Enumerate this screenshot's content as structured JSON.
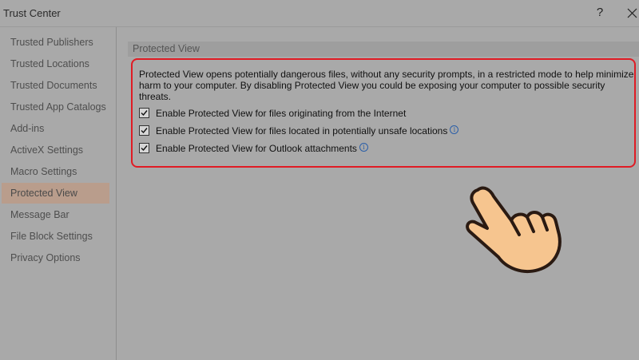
{
  "window": {
    "title": "Trust Center",
    "help_label": "?"
  },
  "sidebar": {
    "items": [
      {
        "label": "Trusted Publishers"
      },
      {
        "label": "Trusted Locations"
      },
      {
        "label": "Trusted Documents"
      },
      {
        "label": "Trusted App Catalogs"
      },
      {
        "label": "Add-ins"
      },
      {
        "label": "ActiveX Settings"
      },
      {
        "label": "Macro Settings"
      },
      {
        "label": "Protected View"
      },
      {
        "label": "Message Bar"
      },
      {
        "label": "File Block Settings"
      },
      {
        "label": "Privacy Options"
      }
    ],
    "selected": "Protected View"
  },
  "main": {
    "section_title": "Protected View",
    "description": "Protected View opens potentially dangerous files, without any security prompts, in a restricted mode to help minimize harm to your computer. By disabling Protected View you could be exposing your computer to possible security threats.",
    "options": [
      {
        "label": "Enable Protected View for files originating from the Internet",
        "checked": true,
        "has_info": false
      },
      {
        "label": "Enable Protected View for files located in potentially unsafe locations",
        "checked": true,
        "has_info": true
      },
      {
        "label": "Enable Protected View for Outlook attachments",
        "checked": true,
        "has_info": true
      }
    ]
  },
  "colors": {
    "highlight_border": "#e01b24",
    "selected_item_bg": "#b99d8c",
    "background": "#a9a9a9",
    "hand_fill": "#f6c58f",
    "hand_outline": "#2a1a12"
  },
  "icons": {
    "close": "close-icon",
    "info": "info-icon",
    "checkmark": "checkmark-icon",
    "pointer_hand": "pointing-hand-icon"
  }
}
